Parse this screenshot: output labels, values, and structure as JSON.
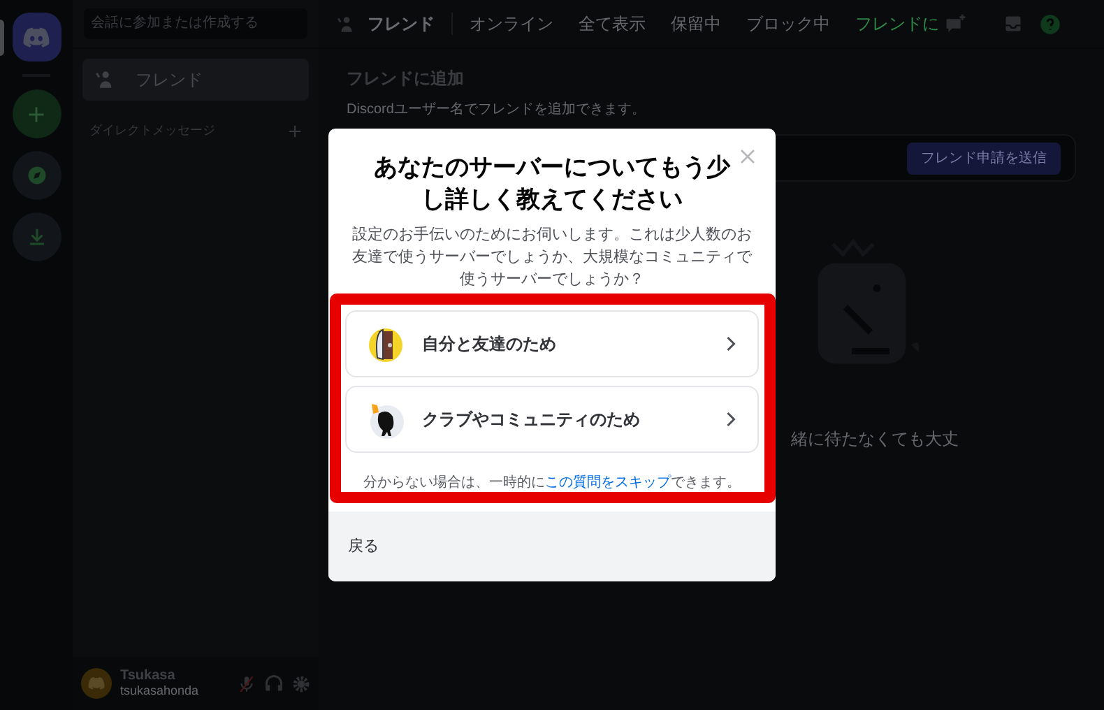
{
  "sidebar": {
    "search_placeholder": "会話に参加または作成する",
    "items": [
      {
        "label": "フレンド",
        "selected": true
      }
    ],
    "section_title": "ダイレクトメッセージ"
  },
  "user_panel": {
    "name": "Tsukasa",
    "username": "tsukasahonda",
    "muted": true
  },
  "header": {
    "title": "フレンド",
    "tabs": [
      {
        "label": "オンライン",
        "selected": false,
        "kind": "tab"
      },
      {
        "label": "全て表示",
        "selected": false,
        "kind": "tab"
      },
      {
        "label": "保留中",
        "selected": false,
        "kind": "tab"
      },
      {
        "label": "ブロック中",
        "selected": false,
        "kind": "tab"
      },
      {
        "label": "フレンドに",
        "selected": false,
        "kind": "add"
      }
    ]
  },
  "add_friend": {
    "title": "フレンドに追加",
    "description": "Discordユーザー名でフレンドを追加できます。",
    "button": "フレンド申請を送信",
    "empty_text": "緒に待たなくても大丈"
  },
  "modal": {
    "title": "あなたのサーバーについてもう少し詳しく教えてください",
    "description": "設定のお手伝いのためにお伺いします。これは少人数のお友達で使うサーバーでしょうか、大規模なコミュニティで使うサーバーでしょうか？",
    "options": [
      {
        "label": "自分と友達のため",
        "kind": "friends"
      },
      {
        "label": "クラブやコミュニティのため",
        "kind": "community"
      }
    ],
    "skip_text_before": "分からない場合は、一時的に",
    "skip_link": "この質問をスキップ",
    "skip_text_after": "できます。",
    "back_button": "戻る"
  }
}
